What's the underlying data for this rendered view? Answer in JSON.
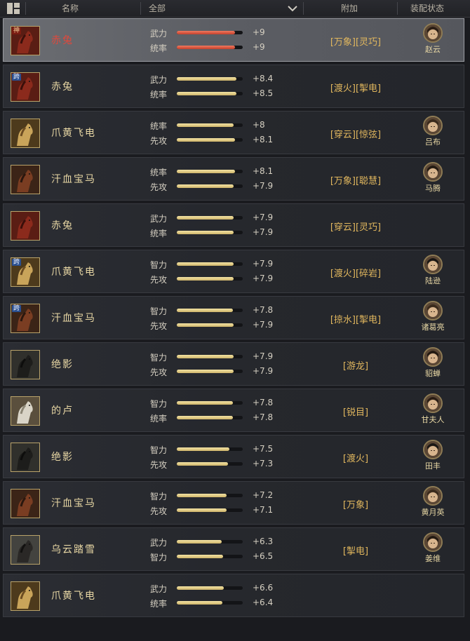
{
  "header": {
    "col_name": "名称",
    "filter_label": "全部",
    "col_addon": "附加",
    "col_equip": "装配状态"
  },
  "rows": [
    {
      "name": "赤兔",
      "red": true,
      "badge": "神",
      "horse": "red",
      "stats": [
        {
          "label": "武力",
          "value": "+9",
          "level": 0.88
        },
        {
          "label": "统率",
          "value": "+9",
          "level": 0.88
        }
      ],
      "addon": "[万象][灵巧]",
      "equipped": "赵云",
      "selected": true
    },
    {
      "name": "赤兔",
      "badge": "跨",
      "horse": "red",
      "stats": [
        {
          "label": "武力",
          "value": "+8.4",
          "level": 0.9
        },
        {
          "label": "统率",
          "value": "+8.5",
          "level": 0.9
        }
      ],
      "addon": "[渡火][掣电]",
      "equipped": ""
    },
    {
      "name": "爪黄飞电",
      "badge": "",
      "horse": "gold",
      "stats": [
        {
          "label": "统率",
          "value": "+8",
          "level": 0.86
        },
        {
          "label": "先攻",
          "value": "+8.1",
          "level": 0.88
        }
      ],
      "addon": "[穿云][惊弦]",
      "equipped": "吕布"
    },
    {
      "name": "汗血宝马",
      "badge": "",
      "horse": "brown",
      "stats": [
        {
          "label": "统率",
          "value": "+8.1",
          "level": 0.88
        },
        {
          "label": "先攻",
          "value": "+7.9",
          "level": 0.86
        }
      ],
      "addon": "[万象][聪慧]",
      "equipped": "马腾"
    },
    {
      "name": "赤兔",
      "badge": "",
      "horse": "red",
      "stats": [
        {
          "label": "武力",
          "value": "+7.9",
          "level": 0.86
        },
        {
          "label": "统率",
          "value": "+7.9",
          "level": 0.86
        }
      ],
      "addon": "[穿云][灵巧]",
      "equipped": ""
    },
    {
      "name": "爪黄飞电",
      "badge": "跨",
      "horse": "gold",
      "stats": [
        {
          "label": "智力",
          "value": "+7.9",
          "level": 0.86
        },
        {
          "label": "先攻",
          "value": "+7.9",
          "level": 0.86
        }
      ],
      "addon": "[渡火][碎岩]",
      "equipped": "陆逊"
    },
    {
      "name": "汗血宝马",
      "badge": "跨",
      "horse": "brown",
      "stats": [
        {
          "label": "智力",
          "value": "+7.8",
          "level": 0.85
        },
        {
          "label": "先攻",
          "value": "+7.9",
          "level": 0.86
        }
      ],
      "addon": "[掠水][掣电]",
      "equipped": "诸葛亮"
    },
    {
      "name": "绝影",
      "badge": "",
      "horse": "black",
      "stats": [
        {
          "label": "智力",
          "value": "+7.9",
          "level": 0.86
        },
        {
          "label": "先攻",
          "value": "+7.9",
          "level": 0.86
        }
      ],
      "addon": "[游龙]",
      "equipped": "貂蝉"
    },
    {
      "name": "的卢",
      "badge": "",
      "horse": "white",
      "stats": [
        {
          "label": "智力",
          "value": "+7.8",
          "level": 0.85
        },
        {
          "label": "统率",
          "value": "+7.8",
          "level": 0.85
        }
      ],
      "addon": "[锐目]",
      "equipped": "甘夫人"
    },
    {
      "name": "绝影",
      "badge": "",
      "horse": "black",
      "stats": [
        {
          "label": "智力",
          "value": "+7.5",
          "level": 0.8
        },
        {
          "label": "先攻",
          "value": "+7.3",
          "level": 0.78
        }
      ],
      "addon": "[渡火]",
      "equipped": "田丰"
    },
    {
      "name": "汗血宝马",
      "badge": "",
      "horse": "brown",
      "stats": [
        {
          "label": "智力",
          "value": "+7.2",
          "level": 0.76
        },
        {
          "label": "先攻",
          "value": "+7.1",
          "level": 0.75
        }
      ],
      "addon": "[万象]",
      "equipped": "黄月英"
    },
    {
      "name": "乌云踏雪",
      "badge": "",
      "horse": "dark",
      "stats": [
        {
          "label": "武力",
          "value": "+6.3",
          "level": 0.68
        },
        {
          "label": "智力",
          "value": "+6.5",
          "level": 0.7
        }
      ],
      "addon": "[掣电]",
      "equipped": "姜维"
    },
    {
      "name": "爪黄飞电",
      "badge": "",
      "horse": "gold",
      "stats": [
        {
          "label": "武力",
          "value": "+6.6",
          "level": 0.71
        },
        {
          "label": "统率",
          "value": "+6.4",
          "level": 0.69
        }
      ],
      "addon": "",
      "equipped": ""
    }
  ],
  "colors": {
    "accent": "#e1b75e",
    "selected_bar": "#d8503a",
    "bar": "#e6d08a",
    "name_red": "#e2483b"
  }
}
